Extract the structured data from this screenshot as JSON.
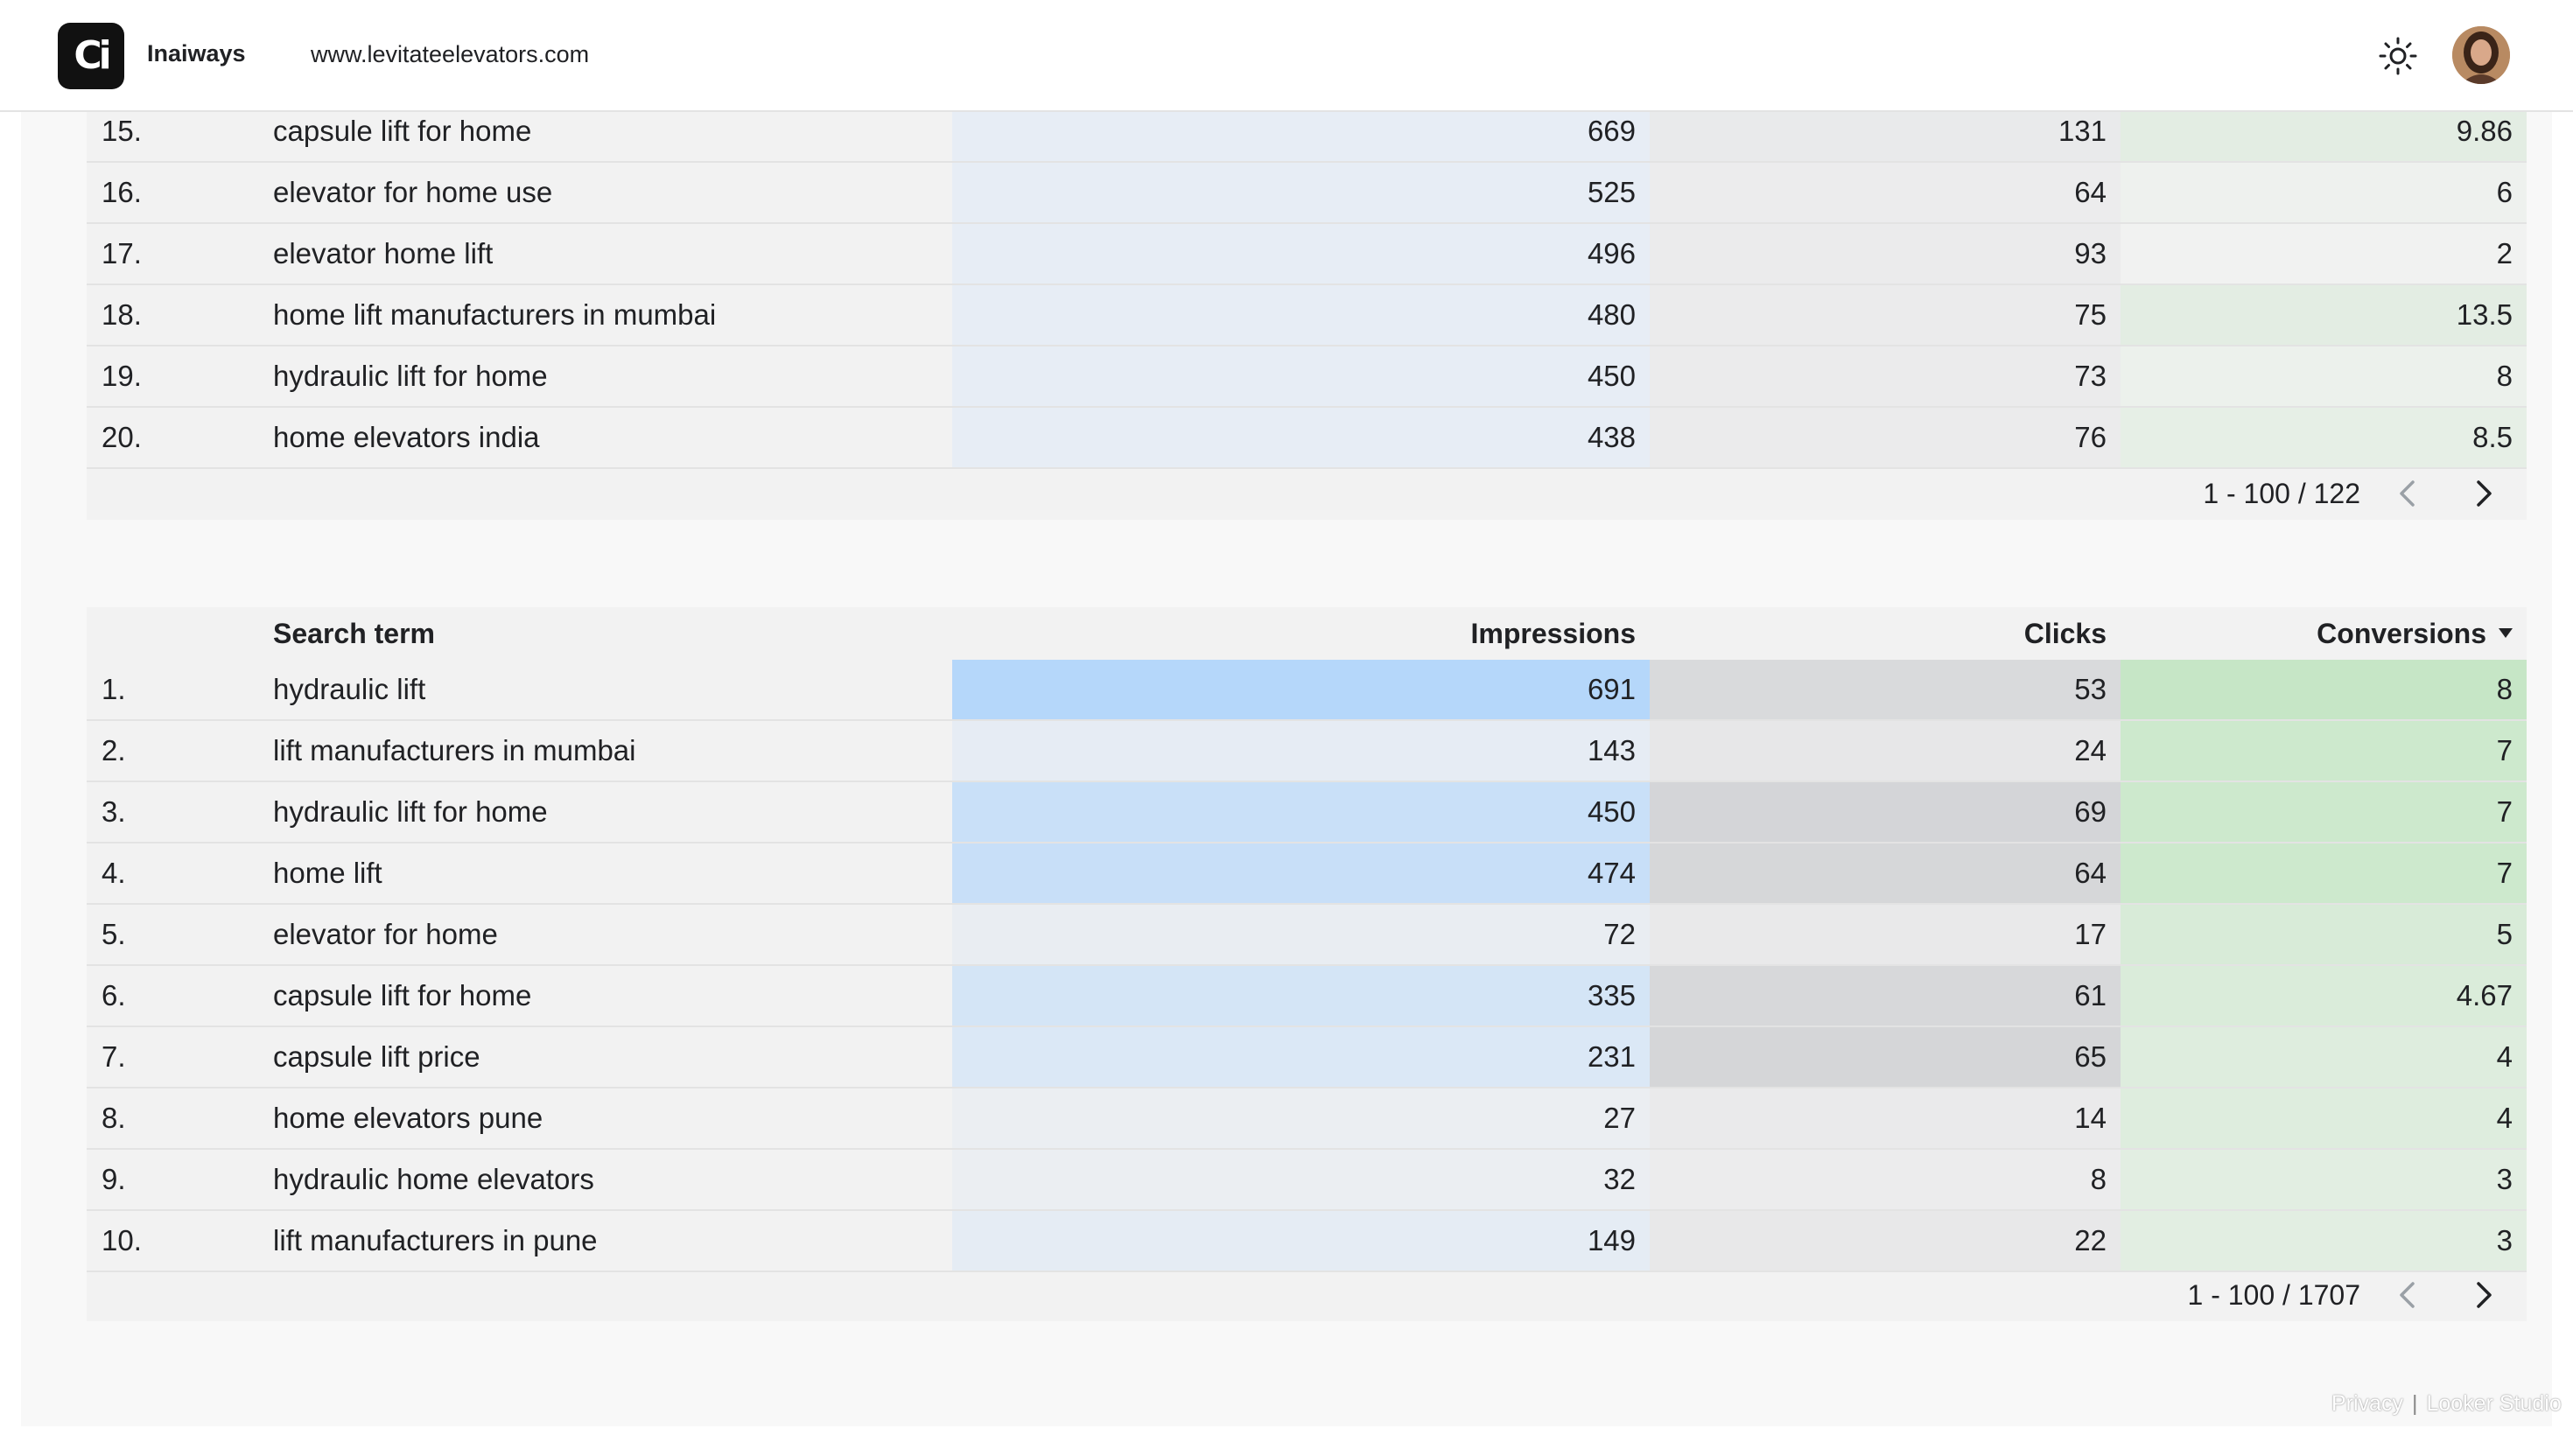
{
  "header": {
    "logo_text": "Ci",
    "brand": "Inaiways",
    "url": "www.levitateelevators.com"
  },
  "colors": {
    "impressions_scale": "#b5d7fa",
    "clicks_scale": "#d4d5d8",
    "conversions_scale": "#c6e6c6",
    "table_bg": "#f2f2f2"
  },
  "table1": {
    "rows": [
      {
        "idx": "15.",
        "term": "capsule lift for home",
        "impressions": "669",
        "clicks": "131",
        "conversions": "9.86",
        "imp_bg": "#e7edf5",
        "clk_bg": "#e9eaeb",
        "conv_bg": "#e3ede3"
      },
      {
        "idx": "16.",
        "term": "elevator for home use",
        "impressions": "525",
        "clicks": "64",
        "conversions": "6",
        "imp_bg": "#e7edf5",
        "clk_bg": "#ececed",
        "conv_bg": "#eef1ee"
      },
      {
        "idx": "17.",
        "term": "elevator home lift",
        "impressions": "496",
        "clicks": "93",
        "conversions": "2",
        "imp_bg": "#e7edf5",
        "clk_bg": "#ebebec",
        "conv_bg": "#f1f2f1"
      },
      {
        "idx": "18.",
        "term": "home lift manufacturers in mumbai",
        "impressions": "480",
        "clicks": "75",
        "conversions": "13.5",
        "imp_bg": "#e7edf5",
        "clk_bg": "#ebebec",
        "conv_bg": "#e3ede3"
      },
      {
        "idx": "19.",
        "term": "hydraulic lift for home",
        "impressions": "450",
        "clicks": "73",
        "conversions": "8",
        "imp_bg": "#e7edf5",
        "clk_bg": "#ebebec",
        "conv_bg": "#ecf1ec"
      },
      {
        "idx": "20.",
        "term": "home elevators india",
        "impressions": "438",
        "clicks": "76",
        "conversions": "8.5",
        "imp_bg": "#e7edf5",
        "clk_bg": "#ebebec",
        "conv_bg": "#e6efe6"
      }
    ],
    "pager": "1 - 100 / 122"
  },
  "table2": {
    "headers": {
      "term": "Search term",
      "impressions": "Impressions",
      "clicks": "Clicks",
      "conversions": "Conversions"
    },
    "rows": [
      {
        "idx": "1.",
        "term": "hydraulic lift",
        "impressions": "691",
        "clicks": "53",
        "conversions": "8",
        "imp_bg": "#b5d7fa",
        "clk_bg": "#d9dadc",
        "conv_bg": "#c6e6c6"
      },
      {
        "idx": "2.",
        "term": "lift manufacturers in mumbai",
        "impressions": "143",
        "clicks": "24",
        "conversions": "7",
        "imp_bg": "#e6ecf4",
        "clk_bg": "#e7e7e8",
        "conv_bg": "#cde9cd"
      },
      {
        "idx": "3.",
        "term": "hydraulic lift for home",
        "impressions": "450",
        "clicks": "69",
        "conversions": "7",
        "imp_bg": "#c9e0f8",
        "clk_bg": "#d4d5d8",
        "conv_bg": "#cde9cd"
      },
      {
        "idx": "4.",
        "term": "home lift",
        "impressions": "474",
        "clicks": "64",
        "conversions": "7",
        "imp_bg": "#c8dff8",
        "clk_bg": "#d6d7d9",
        "conv_bg": "#cde9cd"
      },
      {
        "idx": "5.",
        "term": "elevator for home",
        "impressions": "72",
        "clicks": "17",
        "conversions": "5",
        "imp_bg": "#e9edf2",
        "clk_bg": "#e9e9ea",
        "conv_bg": "#d8ebd8"
      },
      {
        "idx": "6.",
        "term": "capsule lift for home",
        "impressions": "335",
        "clicks": "61",
        "conversions": "4.67",
        "imp_bg": "#d4e5f6",
        "clk_bg": "#d7d8da",
        "conv_bg": "#daecda"
      },
      {
        "idx": "7.",
        "term": "capsule lift price",
        "impressions": "231",
        "clicks": "65",
        "conversions": "4",
        "imp_bg": "#dbe8f6",
        "clk_bg": "#d5d6d8",
        "conv_bg": "#deedde"
      },
      {
        "idx": "8.",
        "term": "home elevators pune",
        "impressions": "27",
        "clicks": "14",
        "conversions": "4",
        "imp_bg": "#ebeef2",
        "clk_bg": "#eaeaeb",
        "conv_bg": "#deedde"
      },
      {
        "idx": "9.",
        "term": "hydraulic home elevators",
        "impressions": "32",
        "clicks": "8",
        "conversions": "3",
        "imp_bg": "#ebeef2",
        "clk_bg": "#ececed",
        "conv_bg": "#e2eee2"
      },
      {
        "idx": "10.",
        "term": "lift manufacturers in pune",
        "impressions": "149",
        "clicks": "22",
        "conversions": "3",
        "imp_bg": "#e5ecf4",
        "clk_bg": "#e8e8e9",
        "conv_bg": "#e2eee2"
      }
    ],
    "pager": "1 - 100 / 1707"
  },
  "footer": {
    "privacy": "Privacy",
    "separator": "|",
    "product": "Looker Studio"
  }
}
